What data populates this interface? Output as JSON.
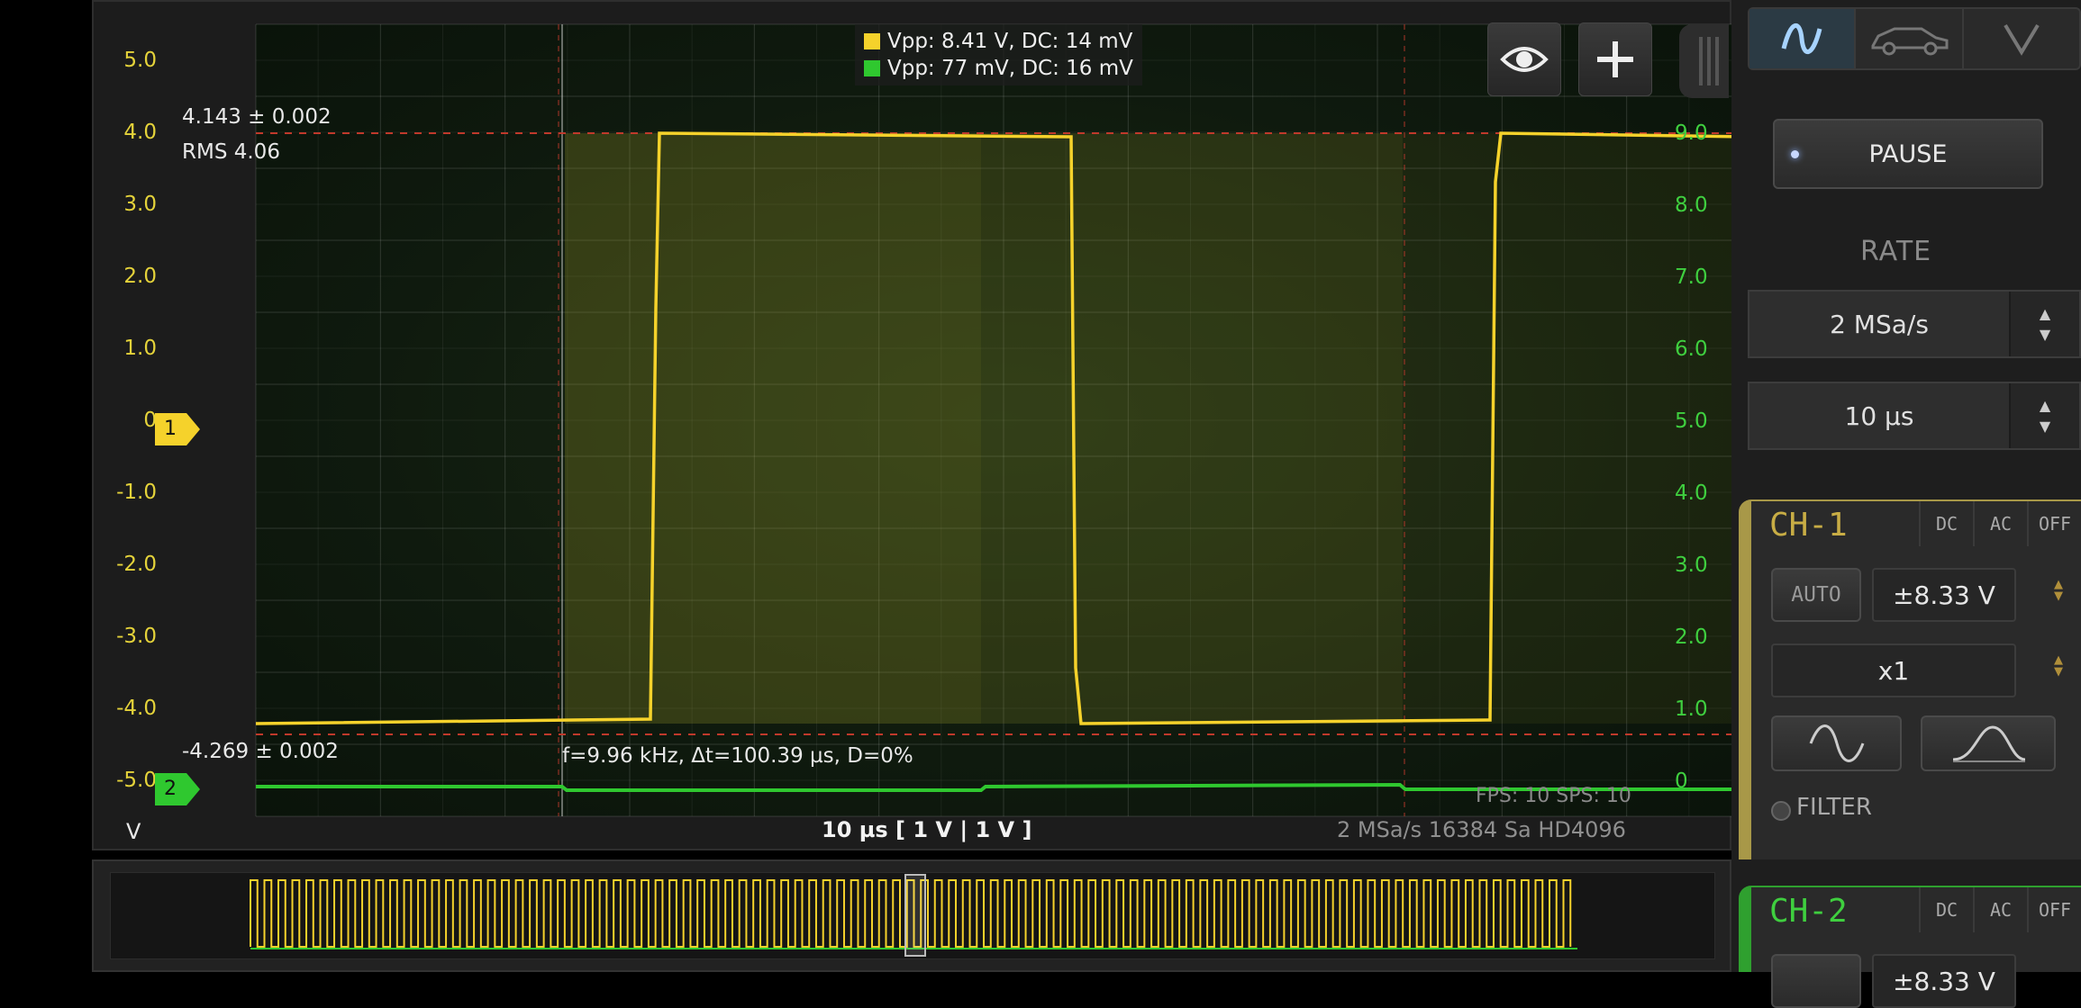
{
  "scope": {
    "y_axis_left": [
      "5.0",
      "4.0",
      "3.0",
      "2.0",
      "1.0",
      "0",
      "-1.0",
      "-2.0",
      "-3.0",
      "-4.0",
      "-5.0"
    ],
    "y_axis_right": [
      "9.0",
      "8.0",
      "7.0",
      "6.0",
      "5.0",
      "4.0",
      "3.0",
      "2.0",
      "1.0",
      "0"
    ],
    "unit_label": "V",
    "ch1_marker": "1",
    "ch2_marker": "2",
    "legend": [
      {
        "text": "Vpp: 8.41 V, DC: 14 mV",
        "color": "#f5d22b"
      },
      {
        "text": "Vpp: 77 mV, DC: 16 mV",
        "color": "#2fc82f"
      }
    ],
    "max_stat": "4.143 ± 0.002",
    "rms_stat": "RMS 4.06",
    "min_stat": "-4.269 ± 0.002",
    "freq_stat": "f=9.96 kHz, Δt=100.39 µs, D=0%",
    "fps_sps": "FPS: 10  SPS: 10",
    "timebase_label": "10 µs  [ 1 V | 1 V ]",
    "sample_info": "2 MSa/s   16384 Sa   HD4096",
    "eye_icon": "eye-icon",
    "add_icon": "plus-icon",
    "colors": {
      "ch1": "#f5d22b",
      "ch2": "#2fc82f",
      "ref": "#c0392b"
    }
  },
  "panel": {
    "tabs": [
      {
        "icon": "sine-wave-icon",
        "active": true
      },
      {
        "icon": "car-icon",
        "active": false
      },
      {
        "icon": "chevron-down-icon",
        "active": false
      }
    ],
    "pause_label": "PAUSE",
    "rate_label": "RATE",
    "rate_value": "2 MSa/s",
    "time_value": "10 µs",
    "ch1": {
      "title": "CH-1",
      "couplings": [
        "DC",
        "AC",
        "OFF"
      ],
      "auto_label": "AUTO",
      "range_value": "±8.33 V",
      "probe_value": "x1",
      "filter_label": "FILTER"
    },
    "ch2": {
      "title": "CH-2",
      "couplings": [
        "DC",
        "AC",
        "OFF"
      ],
      "range_value": "±8.33 V"
    }
  }
}
